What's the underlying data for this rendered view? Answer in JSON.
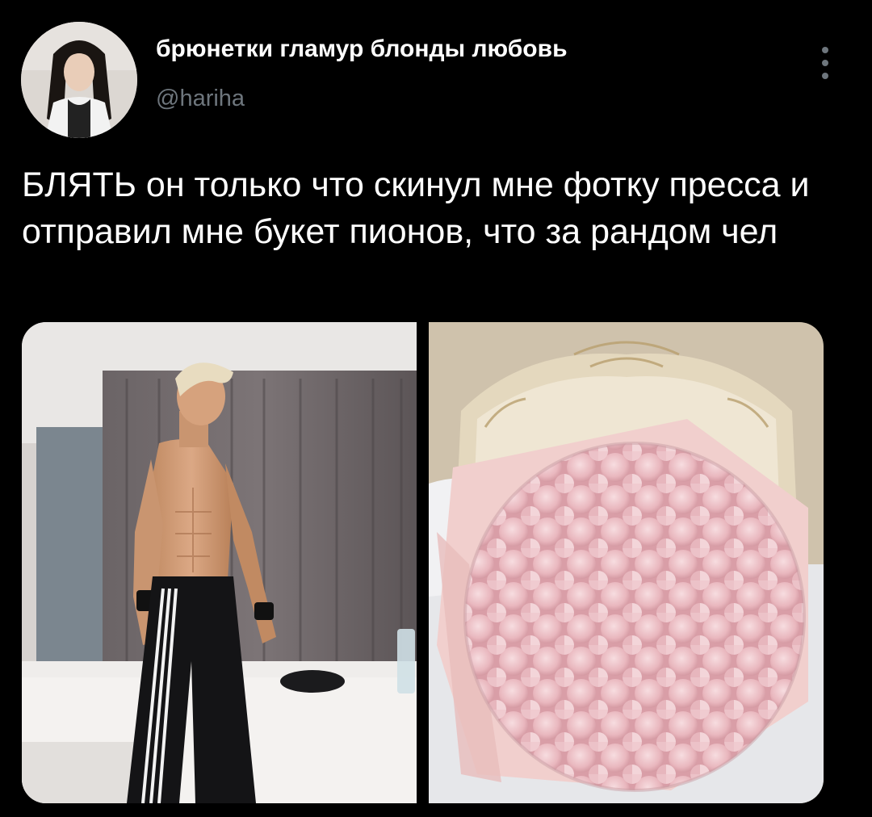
{
  "tweet": {
    "author": {
      "display_name": "брюнетки гламур блонды любовь",
      "handle": "@hariha",
      "avatar_icon": "profile-photo"
    },
    "more_icon": "more-vertical-icon",
    "text": "БЛЯТЬ он только что скинул мне фотку пресса и отправил мне букет пионов, что за рандом чел",
    "media": [
      {
        "kind": "photo",
        "subject": "shirtless man in black track pants in hotel room"
      },
      {
        "kind": "photo",
        "subject": "large bouquet of pink peonies on a bed"
      }
    ]
  },
  "colors": {
    "background": "#000000",
    "text_primary": "#ffffff",
    "text_secondary": "#6e767d"
  }
}
